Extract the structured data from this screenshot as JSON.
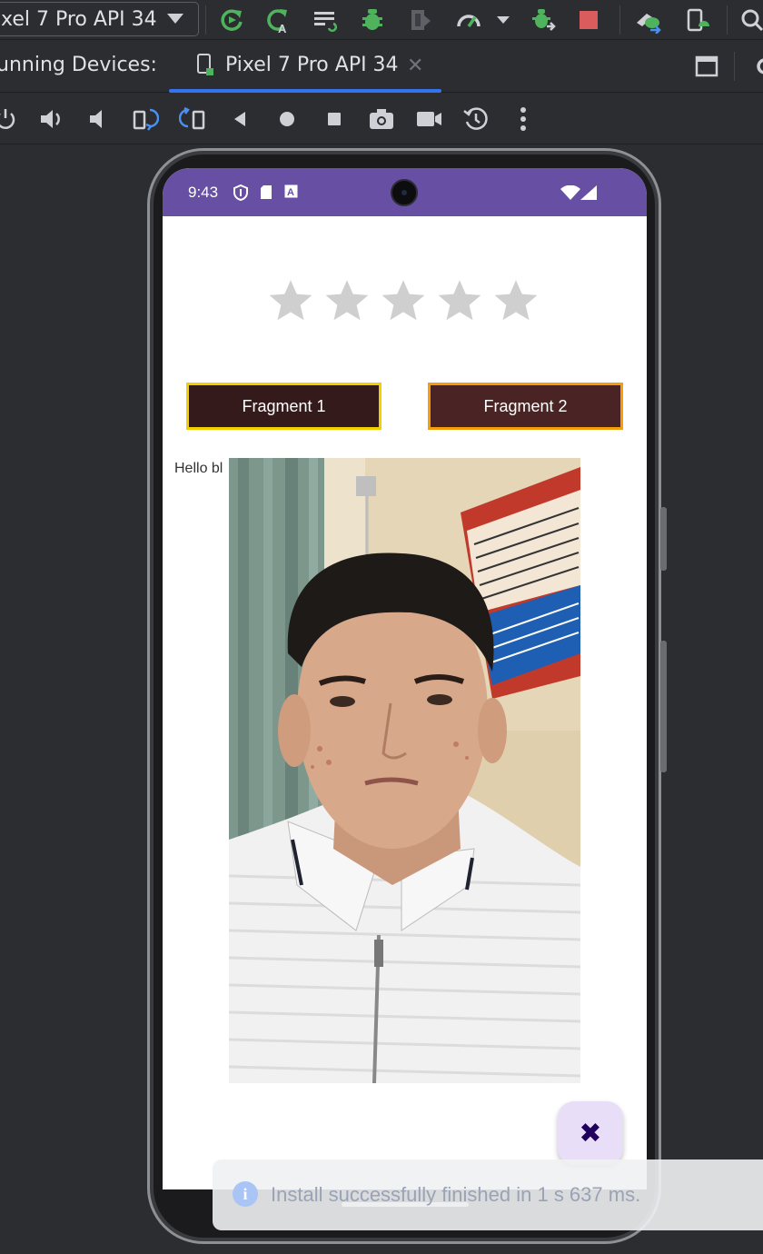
{
  "ide": {
    "device_selector": "xel 7 Pro API 34",
    "running_devices_label": "unning Devices:",
    "device_tab_title": "Pixel 7 Pro API 34",
    "tab_close_glyph": "✕",
    "toolbar_icons": [
      "rerun-icon",
      "apply-code-changes-icon",
      "run-configurations-icon",
      "debug-icon",
      "coverage-icon",
      "profiler-icon",
      "chevron-down-icon",
      "attach-debugger-icon",
      "stop-icon",
      "device-manager-icon",
      "logcat-icon",
      "search-icon"
    ],
    "control_icons": [
      "power-icon",
      "volume-up-icon",
      "volume-down-icon",
      "rotate-left-icon",
      "rotate-right-icon",
      "back-icon",
      "home-icon",
      "overview-icon",
      "screenshot-icon",
      "screen-record-icon",
      "snapshot-icon",
      "more-icon"
    ],
    "colors": {
      "accent": "#3574f0",
      "stop": "#db5c5c",
      "green": "#4fb35e"
    }
  },
  "phone": {
    "status": {
      "time": "9:43"
    },
    "rating": {
      "stars_total": 5,
      "stars_filled": 0
    },
    "buttons": {
      "fragment1": "Fragment 1",
      "fragment2": "Fragment 2"
    },
    "hello_text": "Hello bl",
    "fab_glyph": "✖",
    "colors": {
      "status_bar": "#6750a4",
      "fab_bg": "#e8def8",
      "fab_fg": "#21005d",
      "frag1_border": "#f0d000",
      "frag2_border": "#f59e0b"
    }
  },
  "notification": {
    "icon": "info-icon",
    "icon_glyph": "i",
    "text": "Install successfully finished in 1 s 637 ms."
  }
}
